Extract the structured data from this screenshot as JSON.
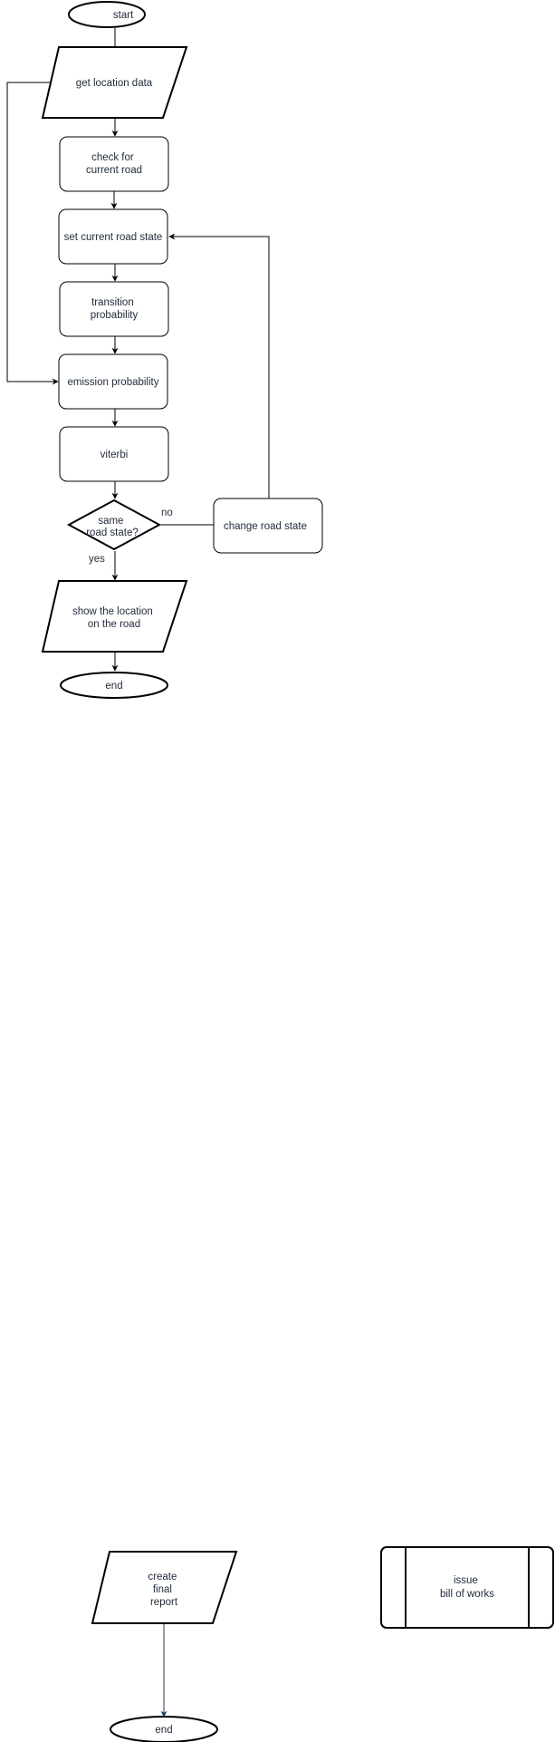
{
  "flowchart": {
    "start": "start",
    "get_location_data": "get location data",
    "check_current_road": [
      "check for",
      "current road"
    ],
    "set_current_road_state": "set current road state",
    "transition_probability": [
      "transition",
      "probability"
    ],
    "emission_probability": "emission probability",
    "viterbi": "viterbi",
    "decision": [
      "same",
      "road state?"
    ],
    "no_label": "no",
    "yes_label": "yes",
    "change_road_state": "change road state",
    "show_location": [
      "show the location",
      "on the road"
    ],
    "end": "end"
  },
  "bottom": {
    "create_final_report": [
      "create",
      "final",
      "report"
    ],
    "issue_bill_of_works": [
      "issue",
      "bill of works"
    ],
    "end": "end"
  }
}
